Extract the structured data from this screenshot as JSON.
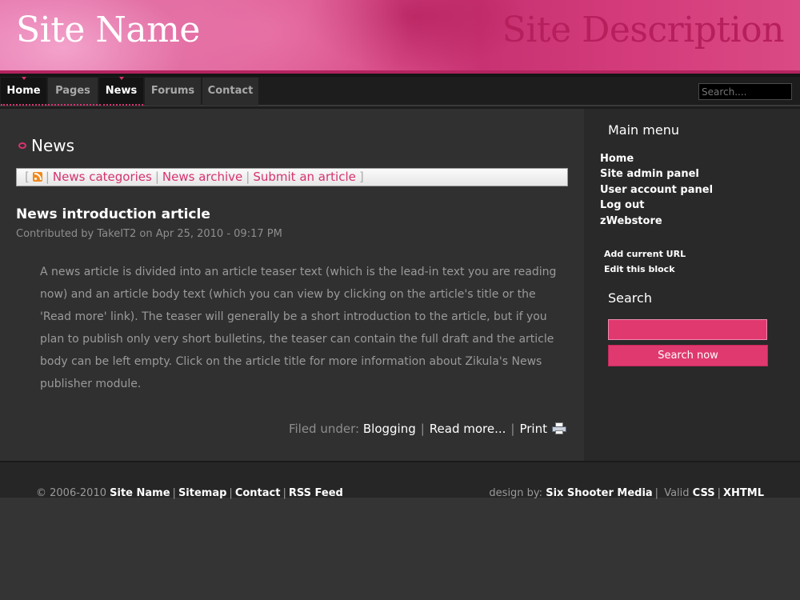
{
  "header": {
    "site_name": "Site Name",
    "site_description": "Site Description"
  },
  "nav": {
    "items": [
      {
        "label": "Home",
        "active": true
      },
      {
        "label": "Pages",
        "active": false
      },
      {
        "label": "News",
        "active": true
      },
      {
        "label": "Forums",
        "active": false
      },
      {
        "label": "Contact",
        "active": false
      }
    ],
    "search_placeholder": "Search...."
  },
  "content": {
    "heading": "News",
    "news_links": [
      "News categories",
      "News archive",
      "Submit an article"
    ],
    "article": {
      "title": "News introduction article",
      "meta": "Contributed by TakeIT2 on Apr 25, 2010 - 09:17 PM",
      "body": "A news article is divided into an article teaser text (which is the lead-in text you are reading now) and an article body text (which you can view by clicking on the article's title or the 'Read more' link). The teaser will generally be a short introduction to the article, but if you plan to publish only very short bulletins, the teaser can contain the full draft and the article body can be left empty. Click on the article title for more information about Zikula's News publisher module."
    },
    "filed_label": "Filed under:",
    "filed_category": "Blogging",
    "read_more": "Read more...",
    "print": "Print"
  },
  "sidebar": {
    "main_menu_title": "Main menu",
    "menu_items": [
      "Home",
      "Site admin panel",
      "User account panel",
      "Log out",
      "zWebstore"
    ],
    "block_links": [
      "Add current URL",
      "Edit this block"
    ],
    "search_title": "Search",
    "search_button": "Search now"
  },
  "footer": {
    "copyright": "© 2006-2010",
    "left_links": [
      "Site Name",
      "Sitemap",
      "Contact",
      "RSS Feed"
    ],
    "design_label": "design by:",
    "designer": "Six Shooter Media",
    "valid_label": "Valid",
    "valid_links": [
      "CSS",
      "XHTML"
    ]
  },
  "colors": {
    "accent": "#d6326f",
    "background": "#343434",
    "nav_background": "#1d1d1d"
  }
}
